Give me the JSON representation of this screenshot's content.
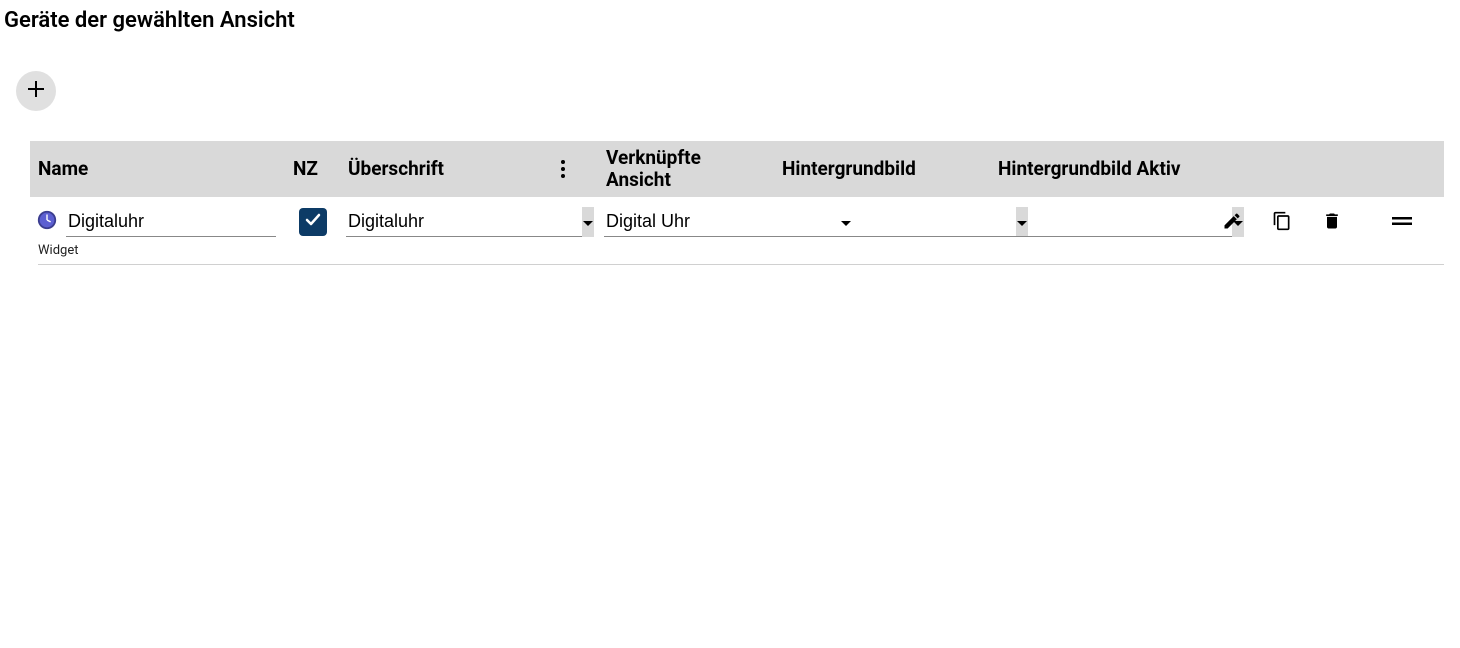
{
  "title": "Geräte der gewählten Ansicht",
  "headers": {
    "name": "Name",
    "nz": "NZ",
    "heading": "Überschrift",
    "linkedview": "Verknüpfte Ansicht",
    "bgimg": "Hintergrundbild",
    "bgimg_active": "Hintergrundbild Aktiv"
  },
  "row": {
    "name": "Digitaluhr",
    "nz_checked": true,
    "heading": "Digitaluhr",
    "linkedview": "Digital Uhr",
    "bgimg": "",
    "bgimg_active": "",
    "subtype": "Widget"
  }
}
